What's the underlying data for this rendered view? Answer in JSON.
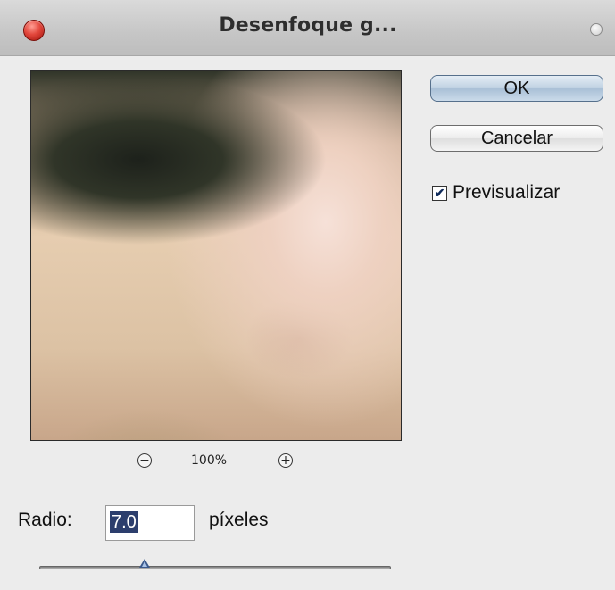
{
  "window": {
    "title": "Desenfoque g...",
    "close_icon": "close-icon",
    "resize_icon": "resize-icon"
  },
  "preview": {
    "zoom_out_glyph": "−",
    "zoom_level": "100%",
    "zoom_in_glyph": "+"
  },
  "buttons": {
    "ok": "OK",
    "cancel": "Cancelar"
  },
  "preview_toggle": {
    "label": "Previsualizar",
    "checked": true,
    "check_glyph": "✔"
  },
  "radius": {
    "label": "Radio:",
    "value": "7.0",
    "unit": "píxeles",
    "slider_position": 0.3
  },
  "colors": {
    "ok_button": "#bfd1e2",
    "slider_thumb": "#3b5a8c",
    "selection": "#2c3e6d"
  }
}
